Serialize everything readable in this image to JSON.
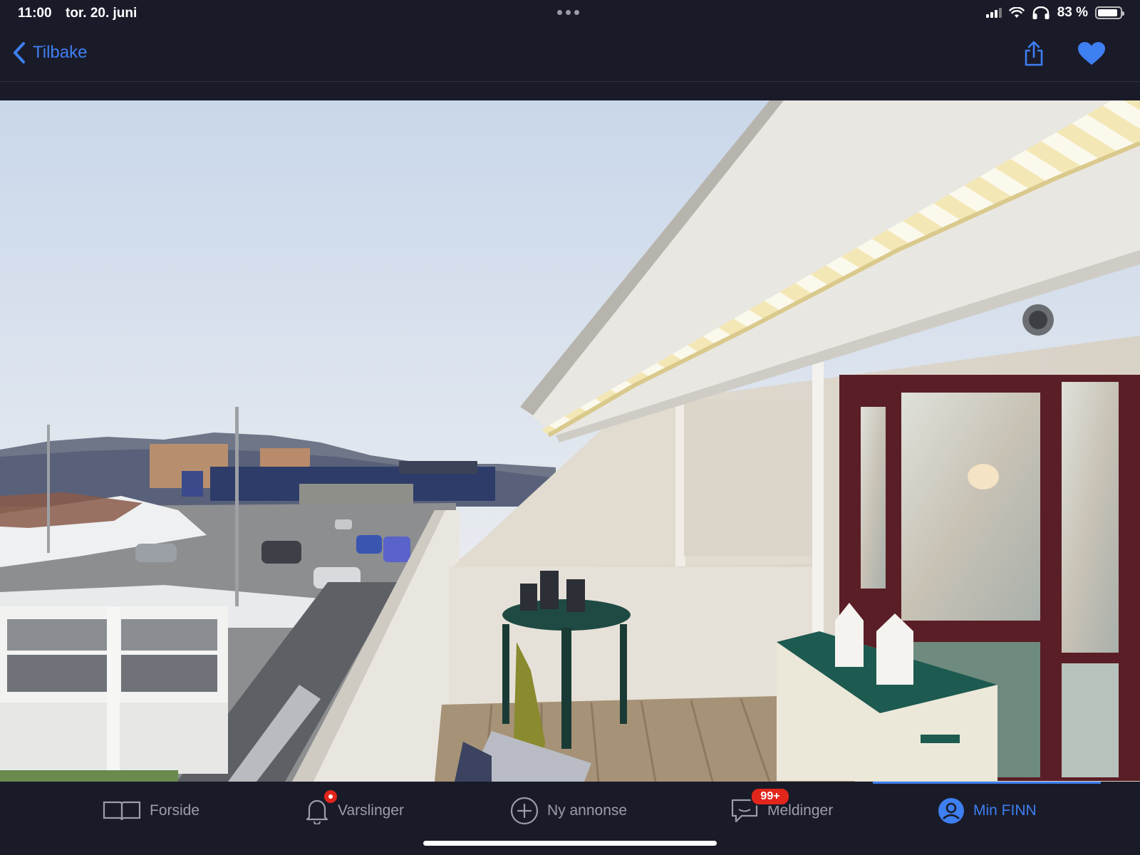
{
  "status_bar": {
    "time": "11:00",
    "date": "tor. 20. juni",
    "battery": "83 %",
    "battery_level": 0.83
  },
  "nav": {
    "back_label": "Tilbake",
    "share_icon": "share-icon",
    "favorite_icon": "heart-icon",
    "favorite_active": true
  },
  "photo": {
    "subject": "balcony-photo"
  },
  "tabs": [
    {
      "label": "Forside",
      "icon": "book-icon",
      "active": false
    },
    {
      "label": "Varslinger",
      "icon": "bell-icon",
      "active": false
    },
    {
      "label": "Ny annonse",
      "icon": "plus-circle-icon",
      "active": false
    },
    {
      "label": "Meldinger",
      "icon": "chat-icon",
      "badge": "99+",
      "active": false
    },
    {
      "label": "Min FINN",
      "icon": "profile-icon",
      "active": true
    }
  ],
  "colors": {
    "accent": "#3e7ff1",
    "background": "#1a1b29",
    "badge": "#e3261c"
  }
}
